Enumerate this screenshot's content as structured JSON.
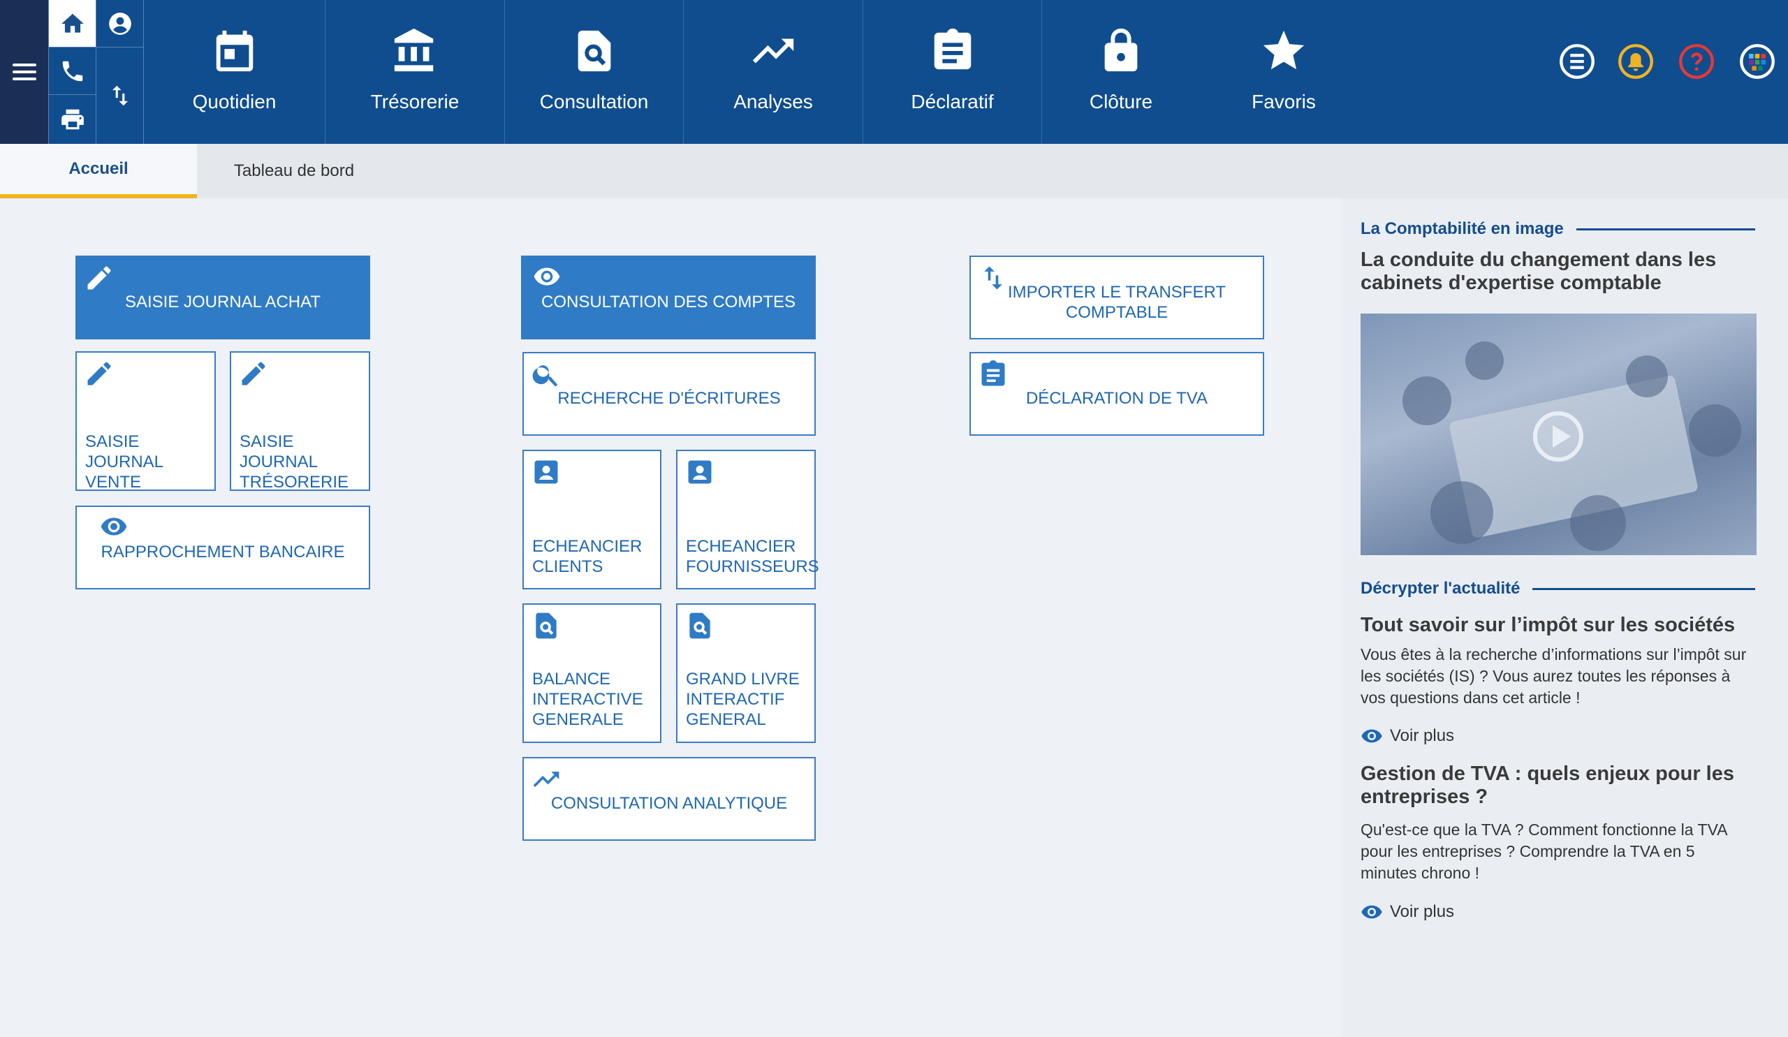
{
  "topnav": {
    "items": [
      {
        "label": "Quotidien",
        "icon": "calendar-icon"
      },
      {
        "label": "Trésorerie",
        "icon": "bank-icon"
      },
      {
        "label": "Consultation",
        "icon": "document-search-icon"
      },
      {
        "label": "Analyses",
        "icon": "trending-up-icon"
      },
      {
        "label": "Déclaratif",
        "icon": "clipboard-icon"
      },
      {
        "label": "Clôture",
        "icon": "lock-icon"
      },
      {
        "label": "Favoris",
        "icon": "star-icon"
      }
    ],
    "colors": {
      "bar": "#0f4d8f",
      "dark": "#1a2f55",
      "user_icon": "#ffffff",
      "bell_icon": "#f0b323",
      "help_icon": "#e53935"
    }
  },
  "tabs": [
    {
      "label": "Accueil"
    },
    {
      "label": "Tableau de bord"
    }
  ],
  "tiles": {
    "col1": [
      {
        "label": "SAISIE JOURNAL ACHAT",
        "icon": "pencil-icon"
      },
      {
        "label": "SAISIE JOURNAL VENTE",
        "icon": "pencil-icon"
      },
      {
        "label": "SAISIE JOURNAL TRÉSORERIE",
        "icon": "pencil-icon"
      },
      {
        "label": "RAPPROCHEMENT BANCAIRE",
        "icon": "eye-icon"
      }
    ],
    "col2": [
      {
        "label": "CONSULTATION DES COMPTES",
        "icon": "eye-icon"
      },
      {
        "label": "RECHERCHE D'ÉCRITURES",
        "icon": "search-icon"
      },
      {
        "label": "ECHEANCIER CLIENTS",
        "icon": "contact-icon"
      },
      {
        "label": "ECHEANCIER FOURNISSEURS",
        "icon": "contact-icon"
      },
      {
        "label": "BALANCE INTERACTIVE GENERALE",
        "icon": "document-search-icon"
      },
      {
        "label": "GRAND LIVRE INTERACTIF GENERAL",
        "icon": "document-search-icon"
      },
      {
        "label": "CONSULTATION ANALYTIQUE",
        "icon": "trending-up-icon"
      }
    ],
    "col3": [
      {
        "label": "IMPORTER LE TRANSFERT COMPTABLE",
        "icon": "swap-vertical-icon"
      },
      {
        "label": "DÉCLARATION DE TVA",
        "icon": "clipboard-icon"
      }
    ]
  },
  "sidebar": {
    "section1": {
      "title": "La Comptabilité en image",
      "headline": "La conduite du changement dans les cabinets d'expertise comptable"
    },
    "section2": {
      "title": "Décrypter l'actualité",
      "articles": [
        {
          "headline": "Tout savoir sur l’impôt sur les sociétés",
          "text": "Vous êtes à la recherche d’informations sur l’impôt sur les sociétés (IS) ? Vous aurez toutes les réponses à vos questions dans cet article !",
          "more": "Voir plus"
        },
        {
          "headline": "Gestion de TVA : quels enjeux pour les entreprises ?",
          "text": "Qu'est-ce que la TVA ? Comment fonctionne la TVA pour les entreprises ? Comprendre la TVA en 5 minutes chrono !",
          "more": "Voir plus"
        }
      ]
    }
  }
}
